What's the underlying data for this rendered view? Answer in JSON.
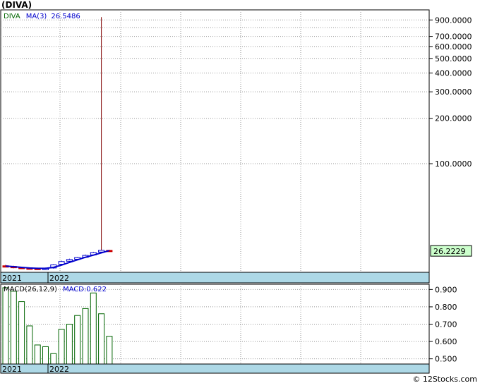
{
  "header": {
    "title": "(DIVA)"
  },
  "footer": {
    "credit": "© 12Stocks.com"
  },
  "colors": {
    "price_legend": "#006400",
    "ma_legend": "#0000cc",
    "ma_line": "#0000cc",
    "up_bar": "#0000cc",
    "down_bar": "#cc0000",
    "spike": "#800000",
    "macd_bar": "#006400",
    "date_band": "#add8e6",
    "last_price_box": "#ccffcc",
    "grid": "#999999"
  },
  "chart_data": [
    {
      "type": "candlestick",
      "legend": {
        "symbol": "DIVA",
        "ma_label": "MA(3)",
        "ma_value": "26.5486"
      },
      "y_scale": "log",
      "ylim": [
        19,
        1050
      ],
      "y_ticks": [
        {
          "value": 900,
          "label": "900.0000"
        },
        {
          "value": 700,
          "label": "700.0000"
        },
        {
          "value": 600,
          "label": "600.0000"
        },
        {
          "value": 500,
          "label": "500.0000"
        },
        {
          "value": 400,
          "label": "400.0000"
        },
        {
          "value": 300,
          "label": "300.0000"
        },
        {
          "value": 200,
          "label": "200.0000"
        },
        {
          "value": 100,
          "label": "100.0000"
        }
      ],
      "x_labels": [
        "2021",
        "2022"
      ],
      "last_price": "26.2229",
      "bars": [
        {
          "x": 1,
          "open": 21.0,
          "close": 20.8,
          "high": 21.3,
          "low": 20.5
        },
        {
          "x": 2,
          "open": 20.8,
          "close": 20.5,
          "high": 21.0,
          "low": 20.2
        },
        {
          "x": 3,
          "open": 20.5,
          "close": 20.3,
          "high": 20.7,
          "low": 20.0
        },
        {
          "x": 4,
          "open": 20.3,
          "close": 20.2,
          "high": 20.5,
          "low": 19.9
        },
        {
          "x": 5,
          "open": 20.2,
          "close": 20.0,
          "high": 20.4,
          "low": 19.8
        },
        {
          "x": 6,
          "open": 20.0,
          "close": 20.2,
          "high": 20.4,
          "low": 19.8
        },
        {
          "x": 7,
          "open": 20.3,
          "close": 21.3,
          "high": 21.5,
          "low": 20.1
        },
        {
          "x": 8,
          "open": 21.5,
          "close": 22.4,
          "high": 22.7,
          "low": 21.3
        },
        {
          "x": 9,
          "open": 22.5,
          "close": 23.1,
          "high": 23.4,
          "low": 22.3
        },
        {
          "x": 10,
          "open": 23.2,
          "close": 23.8,
          "high": 24.0,
          "low": 23.0
        },
        {
          "x": 11,
          "open": 23.9,
          "close": 24.6,
          "high": 24.9,
          "low": 23.7
        },
        {
          "x": 12,
          "open": 24.8,
          "close": 25.7,
          "high": 26.0,
          "low": 24.6
        },
        {
          "x": 13,
          "open": 25.9,
          "close": 26.6,
          "high": 940.0,
          "low": 25.5
        },
        {
          "x": 14,
          "open": 26.6,
          "close": 26.2,
          "high": 26.8,
          "low": 26.0
        }
      ],
      "ma": [
        20.9,
        20.7,
        20.5,
        20.3,
        20.2,
        20.2,
        20.5,
        21.2,
        22.1,
        23.0,
        23.9,
        24.7,
        25.6,
        26.5
      ]
    },
    {
      "type": "bar",
      "legend": {
        "label": "MACD(26,12,9)",
        "value_label": "MACD:0.622"
      },
      "ylim": [
        0.47,
        0.93
      ],
      "y_ticks": [
        {
          "value": 0.9,
          "label": "0.900"
        },
        {
          "value": 0.8,
          "label": "0.800"
        },
        {
          "value": 0.7,
          "label": "0.700"
        },
        {
          "value": 0.6,
          "label": "0.600"
        },
        {
          "value": 0.5,
          "label": "0.500"
        }
      ],
      "x_labels": [
        "2021",
        "2022"
      ],
      "values": [
        0.91,
        0.89,
        0.83,
        0.69,
        0.58,
        0.57,
        0.53,
        0.67,
        0.7,
        0.75,
        0.79,
        0.88,
        0.76,
        0.63
      ]
    }
  ]
}
